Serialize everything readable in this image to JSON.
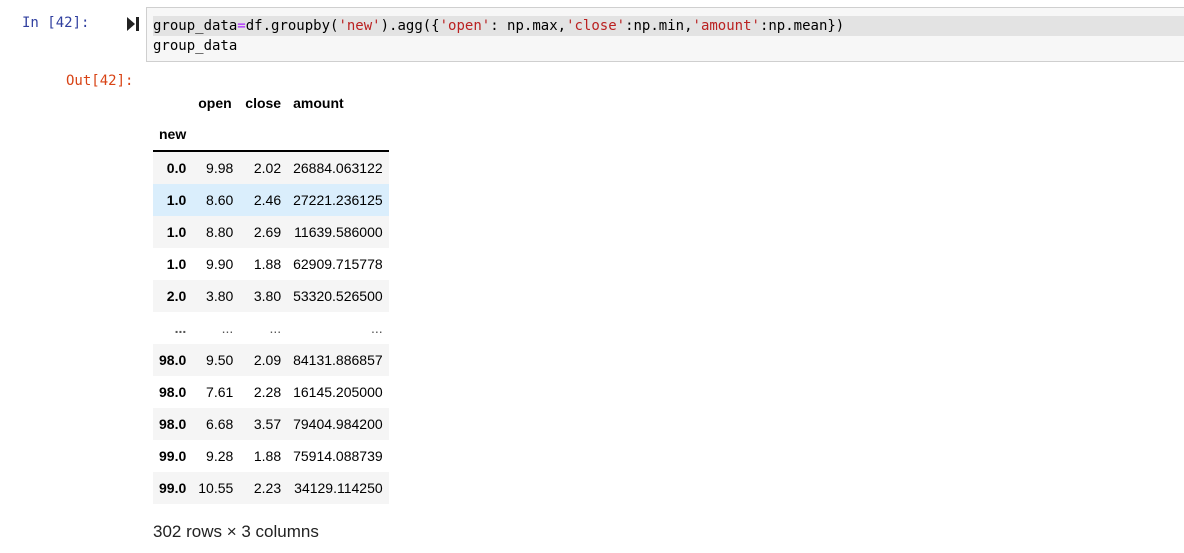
{
  "input_cell": {
    "prompt": "In  [42]:",
    "code_line1": {
      "part1": "group_data",
      "op1": "=",
      "part2": "df.groupby(",
      "str1": "'new'",
      "part3": ").agg({",
      "str2": "'open'",
      "part4": ": np.max,",
      "str3": "'close'",
      "part5": ":np.min,",
      "str4": "'amount'",
      "part6": ":np.mean})"
    },
    "code_line2": "group_data"
  },
  "output_cell": {
    "prompt": "Out[42]:",
    "columns": [
      "open",
      "close",
      "amount"
    ],
    "index_name": "new",
    "rows": [
      {
        "idx": "0.0",
        "open": "9.98",
        "close": "2.02",
        "amount": "26884.063122"
      },
      {
        "idx": "1.0",
        "open": "8.60",
        "close": "2.46",
        "amount": "27221.236125"
      },
      {
        "idx": "1.0",
        "open": "8.80",
        "close": "2.69",
        "amount": "11639.586000"
      },
      {
        "idx": "1.0",
        "open": "9.90",
        "close": "1.88",
        "amount": "62909.715778"
      },
      {
        "idx": "2.0",
        "open": "3.80",
        "close": "3.80",
        "amount": "53320.526500"
      },
      {
        "idx": "...",
        "open": "...",
        "close": "...",
        "amount": "..."
      },
      {
        "idx": "98.0",
        "open": "9.50",
        "close": "2.09",
        "amount": "84131.886857"
      },
      {
        "idx": "98.0",
        "open": "7.61",
        "close": "2.28",
        "amount": "16145.205000"
      },
      {
        "idx": "98.0",
        "open": "6.68",
        "close": "3.57",
        "amount": "79404.984200"
      },
      {
        "idx": "99.0",
        "open": "9.28",
        "close": "1.88",
        "amount": "75914.088739"
      },
      {
        "idx": "99.0",
        "open": "10.55",
        "close": "2.23",
        "amount": "34129.114250"
      }
    ],
    "shape_text": "302 rows × 3 columns"
  },
  "icons": {
    "run": "run-cell-icon"
  }
}
